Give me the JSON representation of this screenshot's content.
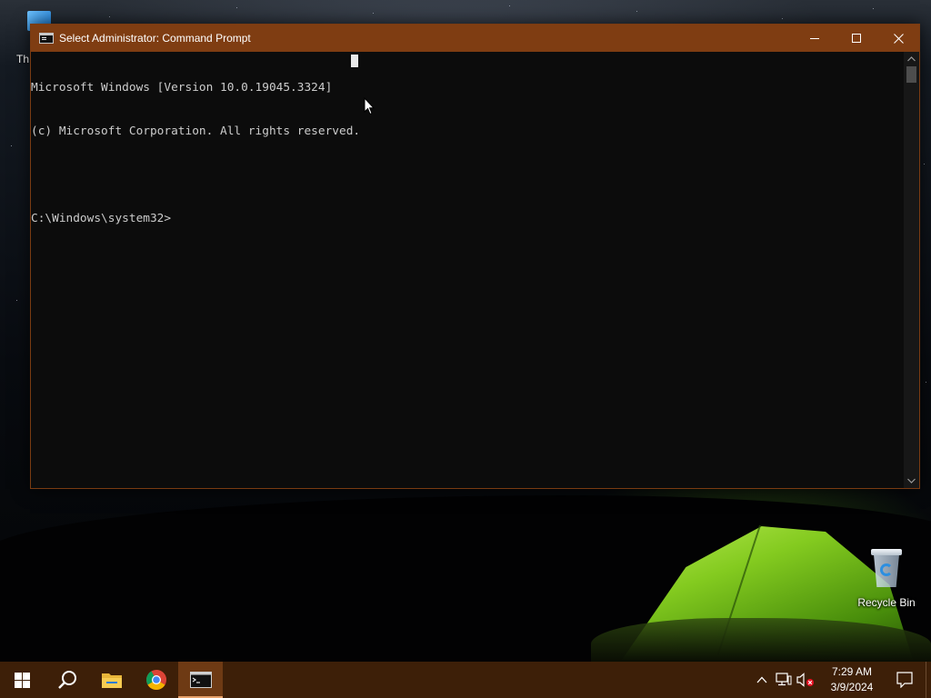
{
  "desktop": {
    "partial_icon_label": "Th",
    "recycle_bin_label": "Recycle Bin"
  },
  "window": {
    "title": "Select Administrator: Command Prompt",
    "controls": {
      "minimize": "minimize-icon",
      "maximize": "maximize-icon",
      "close": "close-icon"
    }
  },
  "console": {
    "lines": [
      "Microsoft Windows [Version 10.0.19045.3324]",
      "(c) Microsoft Corporation. All rights reserved.",
      "",
      "C:\\Windows\\system32>"
    ]
  },
  "taskbar": {
    "apps": [
      {
        "name": "start",
        "icon": "windows-logo-icon"
      },
      {
        "name": "search",
        "icon": "search-icon"
      },
      {
        "name": "file-explorer",
        "icon": "folder-icon"
      },
      {
        "name": "chrome",
        "icon": "chrome-icon"
      },
      {
        "name": "command-prompt",
        "icon": "cmd-icon",
        "active": true
      }
    ],
    "tray": {
      "icons": [
        "chevron-up-icon",
        "network-icon",
        "volume-muted-icon"
      ],
      "time": "7:29 AM",
      "date": "3/9/2024"
    }
  },
  "colors": {
    "titlebar": "#7f3d12",
    "taskbar": "#3d1f08",
    "console_bg": "#0c0c0c",
    "console_text": "#cccccc"
  }
}
